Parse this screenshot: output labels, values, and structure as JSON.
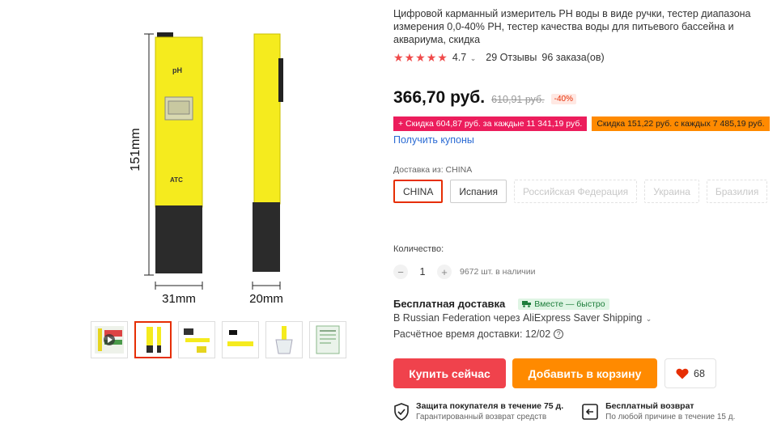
{
  "product": {
    "title": "Цифровой карманный измеритель PH воды в виде ручки, тестер диапазона измерения 0,0-40% PH, тестер качества воды для питьевого бассейна и аквариума, скидка",
    "rating": "4.7",
    "reviews": "29 Отзывы",
    "orders": "96 заказа(ов)",
    "price": "366,70 руб.",
    "old_price": "610,91 руб.",
    "discount": "-40%"
  },
  "gallery": {
    "height_label": "151mm",
    "width_label": "31mm",
    "depth_label": "20mm",
    "device_label_ph": "pH",
    "device_label_atc": "ATC"
  },
  "promos": [
    "+ Скидка 604,87 руб. за каждые 11 341,19 руб.",
    "Скидка 151,22 руб. с каждых 7 485,19 руб."
  ],
  "coupons_link": "Получить купоны",
  "shipping_from": {
    "label": "Доставка из:",
    "selected": "CHINA",
    "options": [
      "CHINA",
      "Испания",
      "Российская Федерация",
      "Украина",
      "Бразилия"
    ]
  },
  "quantity": {
    "label": "Количество:",
    "minus": "−",
    "value": "1",
    "plus": "+",
    "stock": "9672 шт. в наличии"
  },
  "delivery": {
    "title": "Бесплатная доставка",
    "badge": "Вместе — быстро",
    "method": "В Russian Federation через AliExpress Saver Shipping",
    "estimate": "Расчётное время доставки: 12/02"
  },
  "actions": {
    "buy": "Купить сейчас",
    "cart": "Добавить в корзину",
    "wish_count": "68"
  },
  "guarantees": [
    {
      "title": "Защита покупателя в течение 75 д.",
      "sub": "Гарантированный возврат средств"
    },
    {
      "title": "Бесплатный возврат",
      "sub": "По любой причине в течение 15 д."
    }
  ],
  "colors": {
    "accent_red": "#f0424c",
    "accent_orange": "#ff8a00",
    "star_red": "#f04a4a",
    "link_blue": "#2b6bd4"
  }
}
